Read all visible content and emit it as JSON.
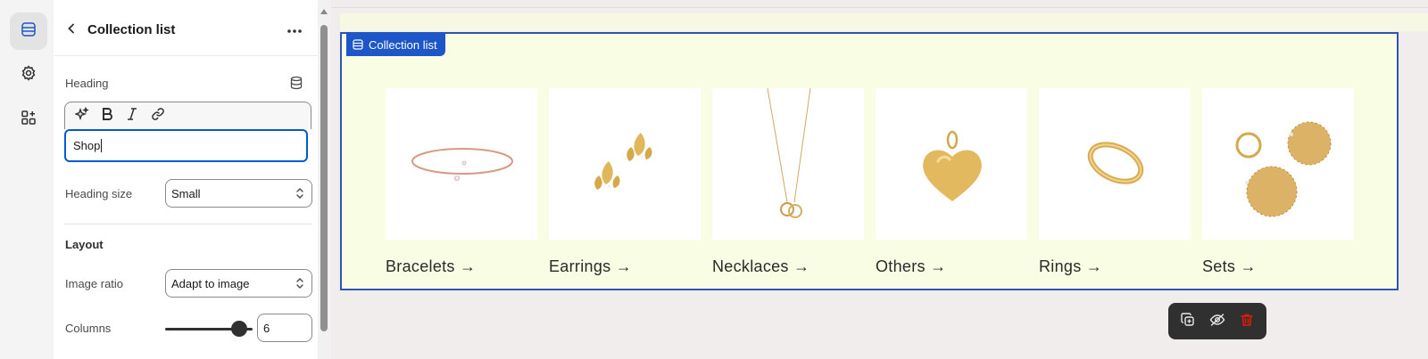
{
  "rail": {
    "items": [
      {
        "name": "sections",
        "icon": "sections-icon",
        "active": true
      },
      {
        "name": "settings",
        "icon": "gear-icon",
        "active": false
      },
      {
        "name": "apps",
        "icon": "apps-add-icon",
        "active": false
      }
    ]
  },
  "panel": {
    "title": "Collection list",
    "heading": {
      "label": "Heading",
      "value": "Shop"
    },
    "heading_size": {
      "label": "Heading size",
      "value": "Small"
    },
    "layout_title": "Layout",
    "image_ratio": {
      "label": "Image ratio",
      "value": "Adapt to image"
    },
    "columns": {
      "label": "Columns",
      "value": "6",
      "slider_fraction": 1.0
    }
  },
  "preview": {
    "section_label": "Collection list",
    "collections": [
      {
        "label": "Bracelets →",
        "icon": "bracelet-image"
      },
      {
        "label": "Earrings →",
        "icon": "earrings-image"
      },
      {
        "label": "Necklaces →",
        "icon": "necklace-image"
      },
      {
        "label": "Others →",
        "icon": "heart-pendant-image"
      },
      {
        "label": "Rings →",
        "icon": "ring-image"
      },
      {
        "label": "Sets →",
        "icon": "jewelry-set-image"
      }
    ]
  },
  "colors": {
    "accent": "#005bd3",
    "section_outline": "#2e54b8",
    "section_bg": "#f9fde3",
    "delete": "#e51c00",
    "gold": "#d9b35a"
  }
}
